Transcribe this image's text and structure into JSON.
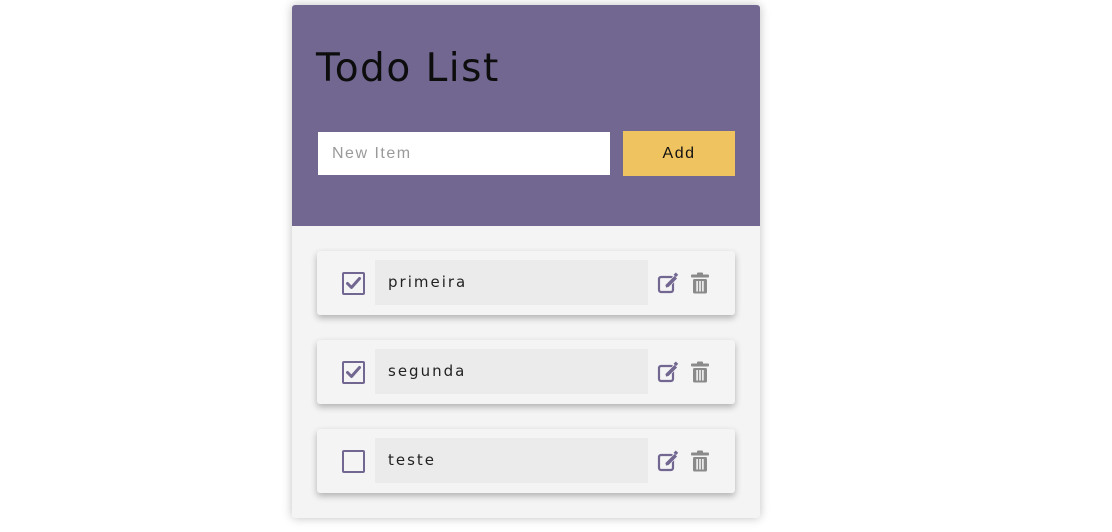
{
  "header": {
    "title": "Todo List",
    "input_placeholder": "New Item",
    "input_value": "",
    "add_label": "Add"
  },
  "items": [
    {
      "text": "primeira",
      "checked": true,
      "edit_icon": "edit-icon",
      "delete_icon": "trash-icon"
    },
    {
      "text": "segunda",
      "checked": true,
      "edit_icon": "edit-icon",
      "delete_icon": "trash-icon"
    },
    {
      "text": "teste",
      "checked": false,
      "edit_icon": "edit-icon",
      "delete_icon": "trash-icon"
    }
  ],
  "colors": {
    "header_bg": "#726791",
    "accent": "#726791",
    "add_button": "#f0c361",
    "trash": "#8a8a8a",
    "card_bg": "#f4f4f4"
  }
}
